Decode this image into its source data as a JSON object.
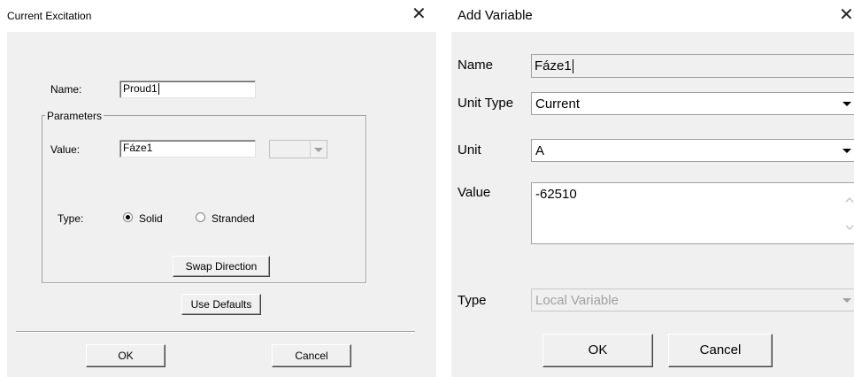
{
  "current_excitation": {
    "title": "Current Excitation",
    "close_glyph": "✕",
    "name_label": "Name:",
    "name_value": "Proud1",
    "parameters_label": "Parameters",
    "value_label": "Value:",
    "value_value": "Fáze1",
    "unit_combo_value": "",
    "type_label": "Type:",
    "radio_solid_label": "Solid",
    "radio_stranded_label": "Stranded",
    "selected_type": "Solid",
    "swap_direction_label": "Swap Direction",
    "use_defaults_label": "Use Defaults",
    "ok_label": "OK",
    "cancel_label": "Cancel"
  },
  "add_variable": {
    "title": "Add Variable",
    "close_glyph": "✕",
    "name_label": "Name",
    "name_value": "Fáze1",
    "unit_type_label": "Unit Type",
    "unit_type_value": "Current",
    "unit_label": "Unit",
    "unit_value": "A",
    "value_label": "Value",
    "value_value": "-62510",
    "type_label": "Type",
    "type_value": "Local Variable",
    "type_disabled": true,
    "ok_label": "OK",
    "cancel_label": "Cancel"
  },
  "icons": [
    "close-icon",
    "chevron-down-icon",
    "scroll-up-icon",
    "scroll-down-icon",
    "radio-button"
  ],
  "colors": {
    "dialog_background": "#f0f0f0",
    "titlebar_background": "#ffffff",
    "disabled_text": "#a0a0a0"
  }
}
